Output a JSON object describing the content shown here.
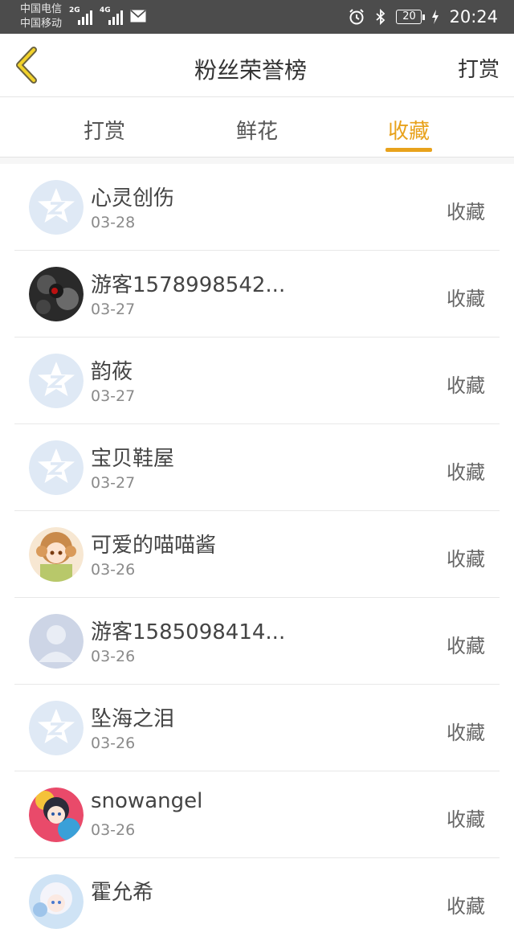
{
  "status_bar": {
    "carrier1": "中国电信",
    "carrier2": "中国移动",
    "net1": "2G",
    "net2": "4G",
    "battery": "20",
    "time": "20:24"
  },
  "header": {
    "title": "粉丝荣誉榜",
    "right_label": "打赏"
  },
  "tabs": [
    {
      "label": "打赏",
      "active": false
    },
    {
      "label": "鲜花",
      "active": false
    },
    {
      "label": "收藏",
      "active": true
    }
  ],
  "accent_color": "#e8a21c",
  "list": [
    {
      "name": "心灵创伤",
      "date": "03-28",
      "action": "收藏",
      "avatar": "default-star-icon"
    },
    {
      "name": "游客1578998542...",
      "date": "03-27",
      "action": "收藏",
      "avatar": "dark-photo"
    },
    {
      "name": "韵莜",
      "date": "03-27",
      "action": "收藏",
      "avatar": "default-star-icon"
    },
    {
      "name": "宝贝鞋屋",
      "date": "03-27",
      "action": "收藏",
      "avatar": "default-star-icon"
    },
    {
      "name": "可爱的喵喵酱",
      "date": "03-26",
      "action": "收藏",
      "avatar": "anime-girl-orange"
    },
    {
      "name": "游客1585098414...",
      "date": "03-26",
      "action": "收藏",
      "avatar": "default-person-icon"
    },
    {
      "name": "坠海之泪",
      "date": "03-26",
      "action": "收藏",
      "avatar": "default-star-icon"
    },
    {
      "name": "snowangel",
      "date": "03-26",
      "action": "收藏",
      "avatar": "anime-girl-colorful"
    },
    {
      "name": "霍允希",
      "date": "",
      "action": "收藏",
      "avatar": "anime-girl-white"
    }
  ]
}
